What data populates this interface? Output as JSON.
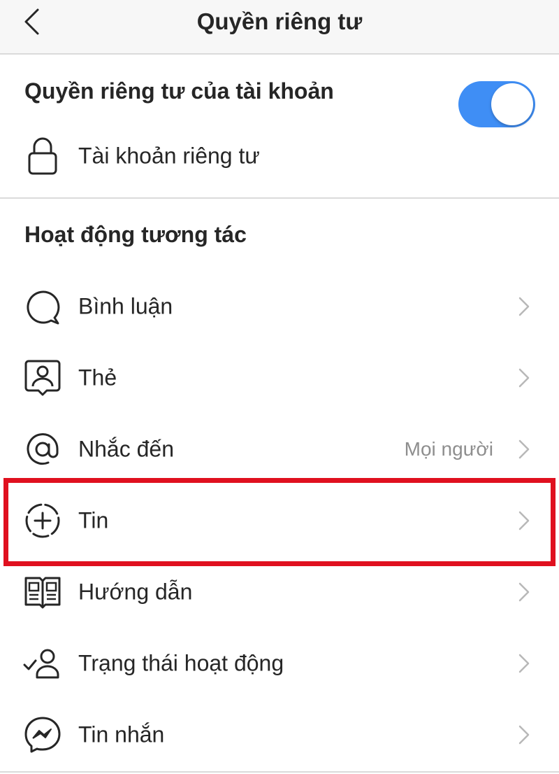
{
  "header": {
    "title": "Quyền riêng tư",
    "back_icon": "chevron-left-icon"
  },
  "account_privacy": {
    "section_title": "Quyền riêng tư của tài khoản",
    "private_account": {
      "label": "Tài khoản riêng tư",
      "icon": "lock-icon",
      "enabled": true
    }
  },
  "interactions": {
    "section_title": "Hoạt động tương tác",
    "items": [
      {
        "label": "Bình luận",
        "icon": "comment-icon",
        "value": ""
      },
      {
        "label": "Thẻ",
        "icon": "tag-person-icon",
        "value": ""
      },
      {
        "label": "Nhắc đến",
        "icon": "at-sign-icon",
        "value": "Mọi người"
      },
      {
        "label": "Tin",
        "icon": "story-add-icon",
        "value": "",
        "highlighted": true
      },
      {
        "label": "Hướng dẫn",
        "icon": "guide-icon",
        "value": ""
      },
      {
        "label": "Trạng thái hoạt động",
        "icon": "activity-status-icon",
        "value": ""
      },
      {
        "label": "Tin nhắn",
        "icon": "messenger-icon",
        "value": ""
      }
    ]
  },
  "colors": {
    "toggle_on": "#3f8ef5",
    "highlight_border": "#e0101f",
    "text_primary": "#262626",
    "text_secondary": "#8e8e8e",
    "divider": "#dbdbdb"
  }
}
